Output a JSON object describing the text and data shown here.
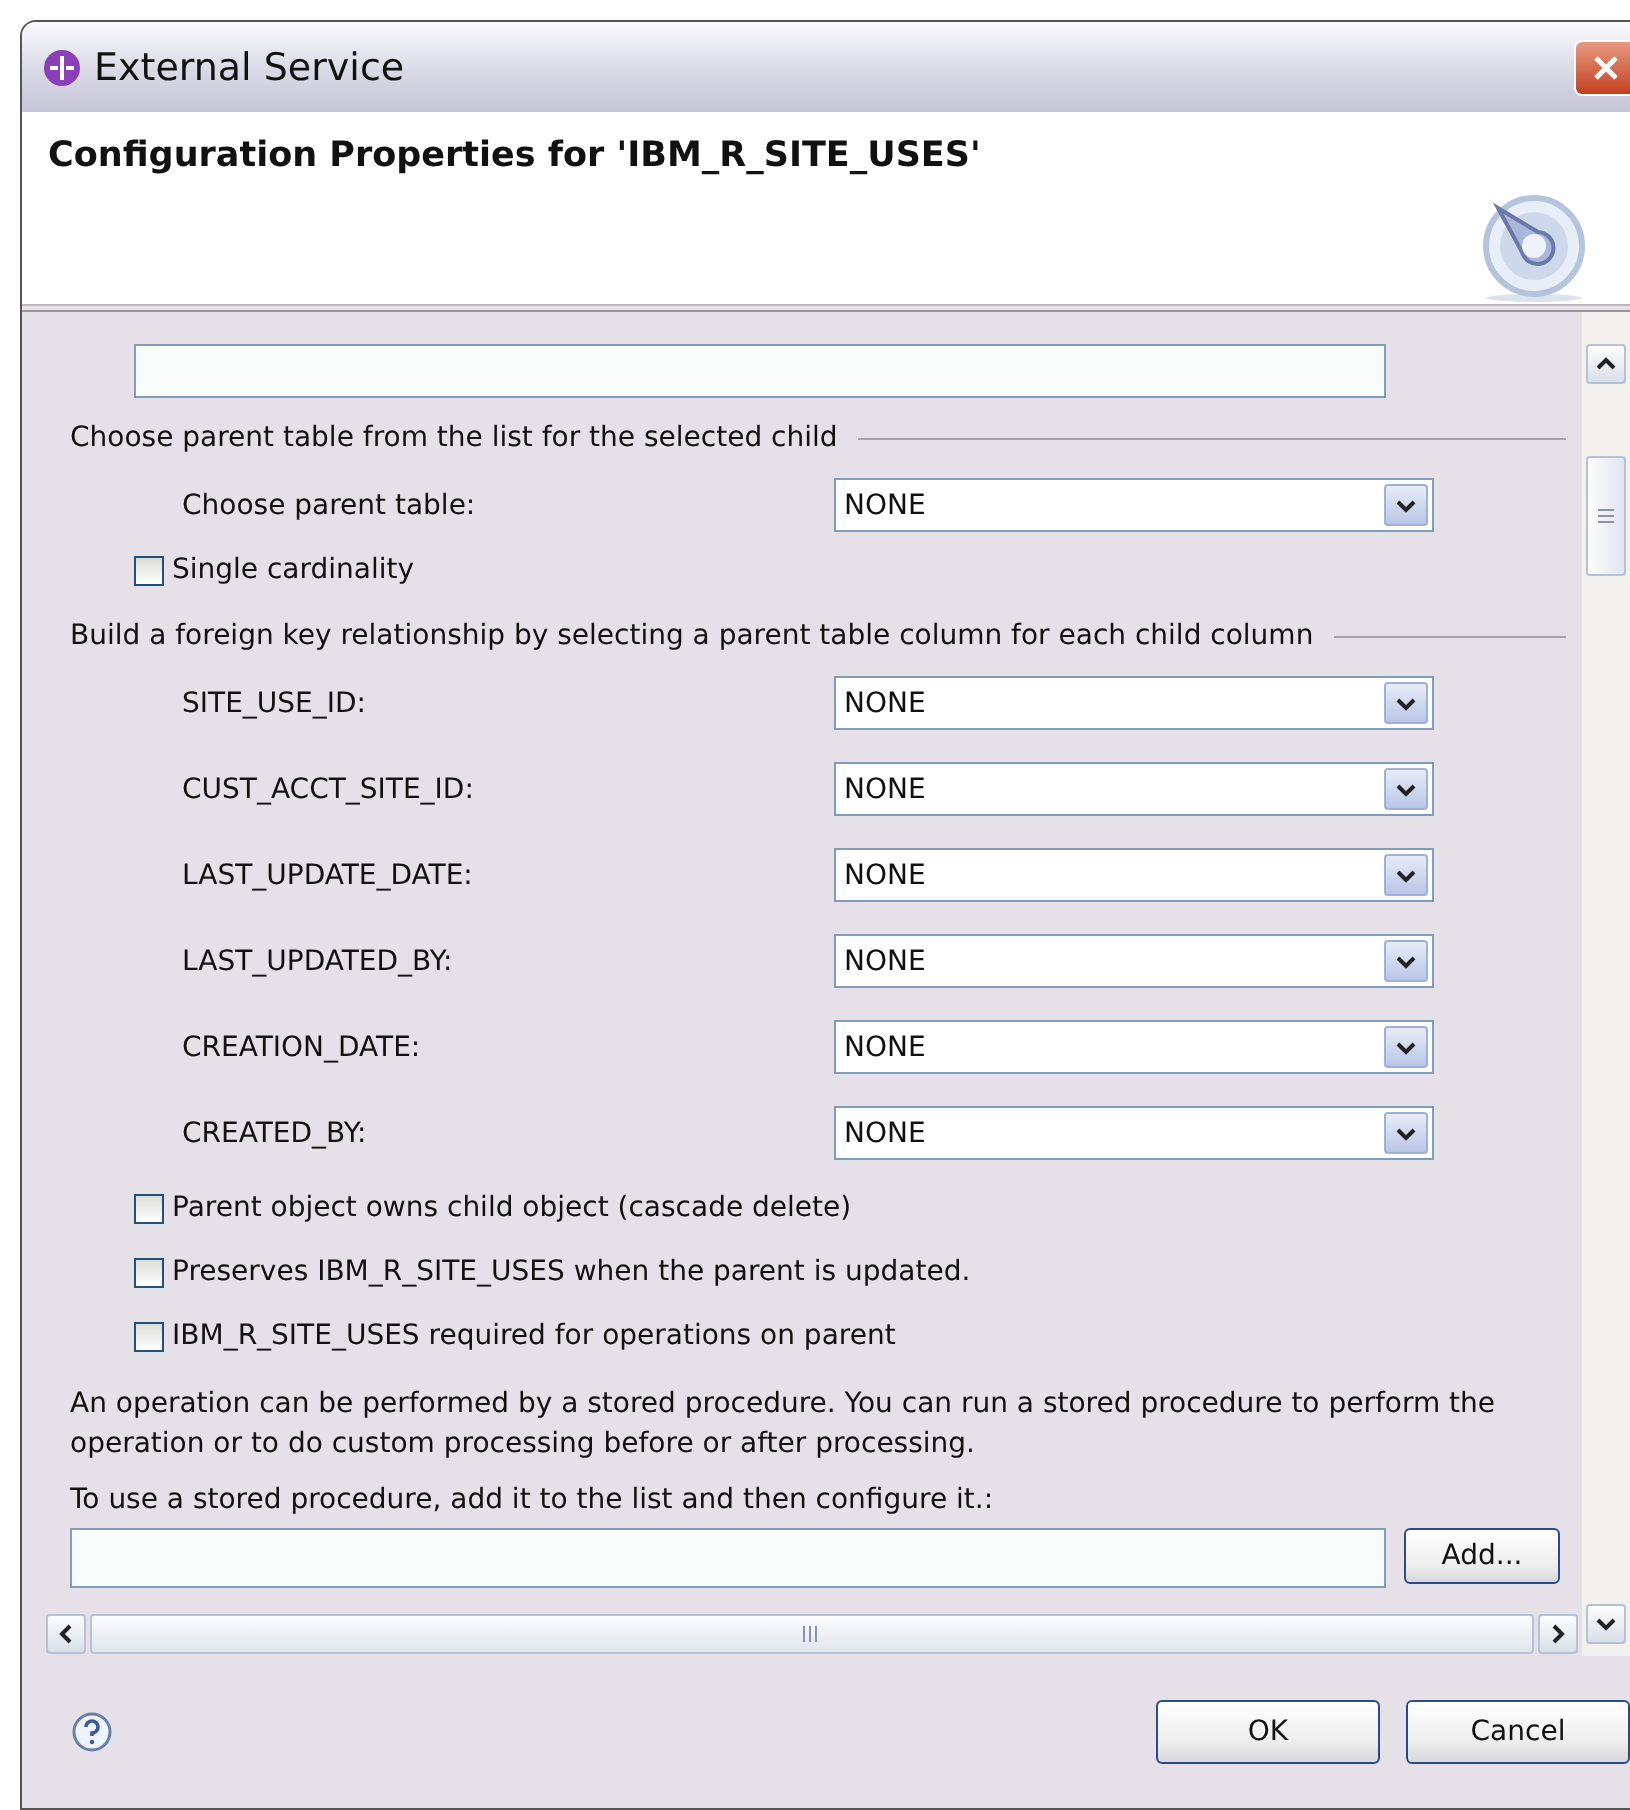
{
  "window": {
    "title": "External Service"
  },
  "header": {
    "title": "Configuration Properties for 'IBM_R_SITE_USES'"
  },
  "parent_group": {
    "heading": "Choose parent table from the list for the selected child",
    "label": "Choose parent table:",
    "value": "NONE",
    "single_cardinality": {
      "label": "Single cardinality",
      "checked": false
    }
  },
  "fk_group": {
    "heading": "Build a foreign key relationship by selecting a parent table column for each child column",
    "columns": [
      {
        "label": "SITE_USE_ID:",
        "value": "NONE"
      },
      {
        "label": "CUST_ACCT_SITE_ID:",
        "value": "NONE"
      },
      {
        "label": "LAST_UPDATE_DATE:",
        "value": "NONE"
      },
      {
        "label": "LAST_UPDATED_BY:",
        "value": "NONE"
      },
      {
        "label": "CREATION_DATE:",
        "value": "NONE"
      },
      {
        "label": "CREATED_BY:",
        "value": "NONE"
      }
    ]
  },
  "options": [
    {
      "label": "Parent object owns child object (cascade delete)",
      "checked": false
    },
    {
      "label": "Preserves IBM_R_SITE_USES when the parent is updated.",
      "checked": false
    },
    {
      "label": "IBM_R_SITE_USES required for operations on parent",
      "checked": false
    }
  ],
  "stored_procedure": {
    "description": "An operation can be performed by a stored procedure. You can run a stored procedure to perform the operation or to do custom processing before or after processing.",
    "instruction": "To use a stored procedure, add it to the list and then configure it.:",
    "add_button": "Add..."
  },
  "buttons": {
    "ok": "OK",
    "cancel": "Cancel"
  }
}
